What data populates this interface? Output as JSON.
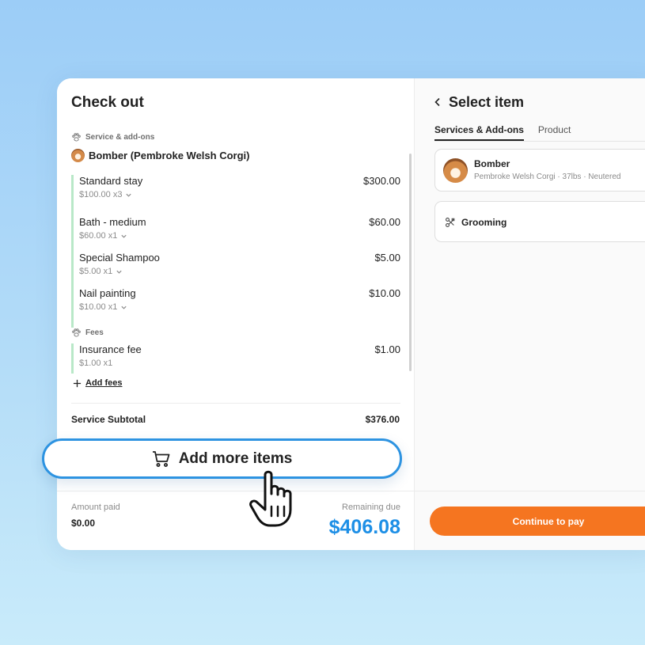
{
  "checkout": {
    "title": "Check out",
    "service_section": "Service & add-ons",
    "pet_name": "Bomber (Pembroke Welsh Corgi)",
    "services": [
      {
        "name": "Standard stay",
        "qty": "$100.00 x3",
        "price": "$300.00"
      },
      {
        "name": "Bath - medium",
        "qty": "$60.00 x1",
        "price": "$60.00"
      },
      {
        "name": "Special Shampoo",
        "qty": "$5.00 x1",
        "price": "$5.00"
      },
      {
        "name": "Nail painting",
        "qty": "$10.00 x1",
        "price": "$10.00"
      }
    ],
    "fees_section": "Fees",
    "fees": [
      {
        "name": "Insurance fee",
        "qty": "$1.00 x1",
        "price": "$1.00"
      }
    ],
    "add_fees_label": "Add fees",
    "subtotal_label": "Service Subtotal",
    "subtotal_value": "$376.00",
    "add_more_label": "Add more items",
    "amount_paid_label": "Amount paid",
    "amount_paid_value": "$0.00",
    "remaining_label": "Remaining due",
    "remaining_value": "$406.08"
  },
  "select_item": {
    "title": "Select item",
    "tabs": [
      {
        "label": "Services & Add-ons",
        "active": true
      },
      {
        "label": "Product",
        "active": false
      }
    ],
    "pet_card": {
      "name": "Bomber",
      "description": "Pembroke Welsh Corgi · 37lbs · Neutered"
    },
    "grooming_label": "Grooming",
    "continue_label": "Continue to pay"
  },
  "colors": {
    "accent_blue": "#1d8fe6",
    "continue_orange": "#f57520",
    "service_bar": "#b9e8c8"
  },
  "icons": [
    "paw-icon",
    "chevron-down-icon",
    "plus-icon",
    "cart-icon",
    "back-chevron-icon",
    "grooming-icon",
    "pointer-hand-icon"
  ]
}
